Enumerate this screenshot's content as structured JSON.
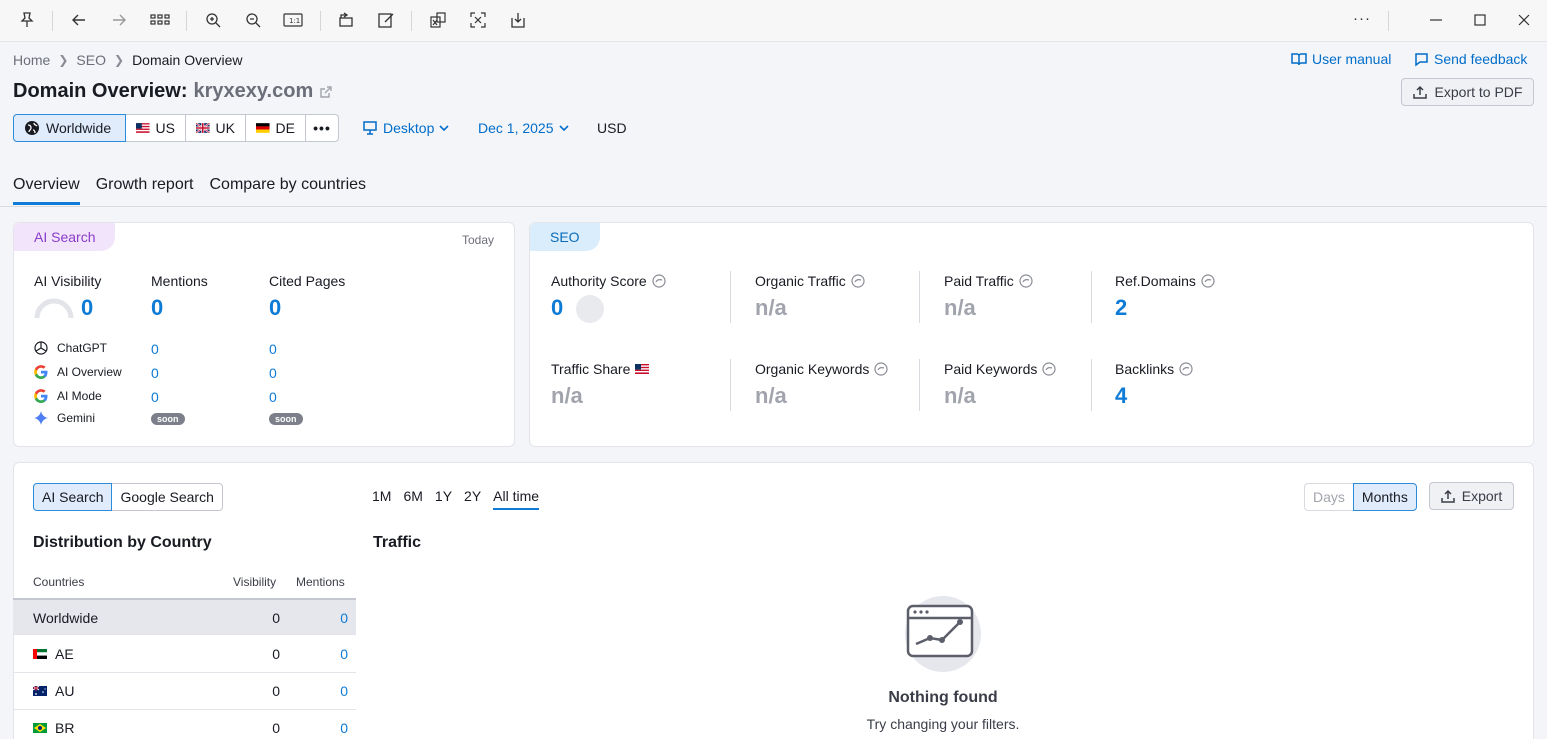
{
  "toolbar": {
    "more": "···"
  },
  "breadcrumb": [
    "Home",
    "SEO",
    "Domain Overview"
  ],
  "header": {
    "title": "Domain Overview:",
    "domain": "kryxexy.com",
    "user_manual": "User manual",
    "send_feedback": "Send feedback",
    "export_pdf": "Export to PDF"
  },
  "regions": [
    {
      "label": "Worldwide",
      "active": true
    },
    {
      "label": "US"
    },
    {
      "label": "UK"
    },
    {
      "label": "DE"
    }
  ],
  "regions_more": "•••",
  "device": "Desktop",
  "date": "Dec 1, 2025",
  "currency": "USD",
  "tabs": [
    "Overview",
    "Growth report",
    "Compare by countries"
  ],
  "ai_card": {
    "pill": "AI Search",
    "when": "Today",
    "visibility_label": "AI Visibility",
    "visibility_value": "0",
    "mentions_label": "Mentions",
    "mentions_value": "0",
    "cited_label": "Cited Pages",
    "cited_value": "0",
    "engines": [
      {
        "name": "ChatGPT",
        "mentions": "0",
        "cited": "0"
      },
      {
        "name": "AI Overview",
        "mentions": "0",
        "cited": "0"
      },
      {
        "name": "AI Mode",
        "mentions": "0",
        "cited": "0"
      },
      {
        "name": "Gemini",
        "mentions": "soon",
        "cited": "soon"
      }
    ]
  },
  "seo_card": {
    "pill": "SEO",
    "metrics": [
      {
        "label": "Authority Score",
        "value": "0"
      },
      {
        "label": "Organic Traffic",
        "value": "n/a"
      },
      {
        "label": "Paid Traffic",
        "value": "n/a"
      },
      {
        "label": "Ref.Domains",
        "value": "2"
      },
      {
        "label": "Traffic Share",
        "value": "n/a"
      },
      {
        "label": "Organic Keywords",
        "value": "n/a"
      },
      {
        "label": "Paid Keywords",
        "value": "n/a"
      },
      {
        "label": "Backlinks",
        "value": "4"
      }
    ]
  },
  "lower": {
    "source_toggle": [
      "AI Search",
      "Google Search"
    ],
    "periods": [
      "1M",
      "6M",
      "1Y",
      "2Y",
      "All time"
    ],
    "granularity": [
      "Days",
      "Months"
    ],
    "export": "Export",
    "dist_title": "Distribution by Country",
    "traffic_title": "Traffic",
    "columns": [
      "Countries",
      "Visibility",
      "Mentions"
    ],
    "rows": [
      {
        "country": "Worldwide",
        "visibility": "0",
        "mentions": "0"
      },
      {
        "country": "AE",
        "visibility": "0",
        "mentions": "0"
      },
      {
        "country": "AU",
        "visibility": "0",
        "mentions": "0"
      },
      {
        "country": "BR",
        "visibility": "0",
        "mentions": "0"
      }
    ],
    "empty_title": "Nothing found",
    "empty_sub": "Try changing your filters."
  }
}
